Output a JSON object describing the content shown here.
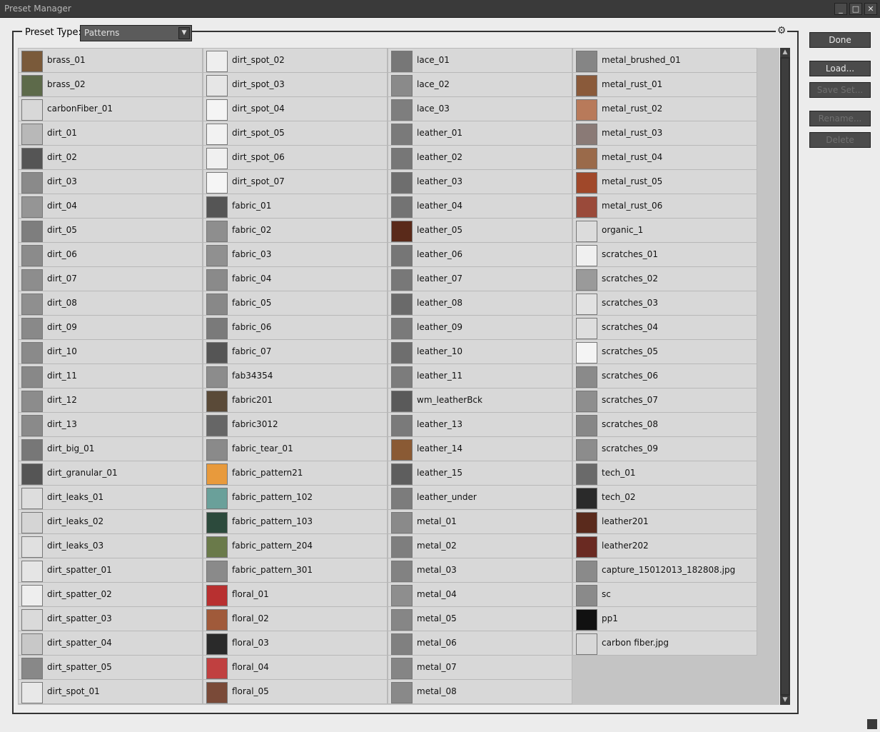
{
  "window": {
    "title": "Preset Manager"
  },
  "preset_type": {
    "label": "Preset Type:",
    "value": "Patterns"
  },
  "buttons": {
    "done": "Done",
    "load": "Load...",
    "save_set": "Save Set...",
    "rename": "Rename...",
    "delete": "Delete"
  },
  "columns": [
    [
      {
        "label": "brass_01",
        "color": "#7a5a3a"
      },
      {
        "label": "brass_02",
        "color": "#5d6a4a"
      },
      {
        "label": "carbonFiber_01",
        "color": "#d8d8d8"
      },
      {
        "label": "dirt_01",
        "color": "#b8b8b8"
      },
      {
        "label": "dirt_02",
        "color": "#555555"
      },
      {
        "label": "dirt_03",
        "color": "#8a8a8a"
      },
      {
        "label": "dirt_04",
        "color": "#959595"
      },
      {
        "label": "dirt_05",
        "color": "#7e7e7e"
      },
      {
        "label": "dirt_06",
        "color": "#8b8b8b"
      },
      {
        "label": "dirt_07",
        "color": "#8d8d8d"
      },
      {
        "label": "dirt_08",
        "color": "#8f8f8f"
      },
      {
        "label": "dirt_09",
        "color": "#898989"
      },
      {
        "label": "dirt_10",
        "color": "#8a8a8a"
      },
      {
        "label": "dirt_11",
        "color": "#888888"
      },
      {
        "label": "dirt_12",
        "color": "#8c8c8c"
      },
      {
        "label": "dirt_13",
        "color": "#8a8a8a"
      },
      {
        "label": "dirt_big_01",
        "color": "#777777"
      },
      {
        "label": "dirt_granular_01",
        "color": "#555555"
      },
      {
        "label": "dirt_leaks_01",
        "color": "#dddddd"
      },
      {
        "label": "dirt_leaks_02",
        "color": "#d5d5d5"
      },
      {
        "label": "dirt_leaks_03",
        "color": "#e0e0e0"
      },
      {
        "label": "dirt_spatter_01",
        "color": "#e5e5e5"
      },
      {
        "label": "dirt_spatter_02",
        "color": "#eeeeee"
      },
      {
        "label": "dirt_spatter_03",
        "color": "#dadada"
      },
      {
        "label": "dirt_spatter_04",
        "color": "#c8c8c8"
      },
      {
        "label": "dirt_spatter_05",
        "color": "#888888"
      },
      {
        "label": "dirt_spot_01",
        "color": "#e8e8e8"
      }
    ],
    [
      {
        "label": "dirt_spot_02",
        "color": "#eeeeee"
      },
      {
        "label": "dirt_spot_03",
        "color": "#e6e6e6"
      },
      {
        "label": "dirt_spot_04",
        "color": "#f4f4f4"
      },
      {
        "label": "dirt_spot_05",
        "color": "#f2f2f2"
      },
      {
        "label": "dirt_spot_06",
        "color": "#f0f0f0"
      },
      {
        "label": "dirt_spot_07",
        "color": "#f5f5f5"
      },
      {
        "label": "fabric_01",
        "color": "#555555"
      },
      {
        "label": "fabric_02",
        "color": "#8e8e8e"
      },
      {
        "label": "fabric_03",
        "color": "#909090"
      },
      {
        "label": "fabric_04",
        "color": "#8a8a8a"
      },
      {
        "label": "fabric_05",
        "color": "#888888"
      },
      {
        "label": "fabric_06",
        "color": "#7a7a7a"
      },
      {
        "label": "fabric_07",
        "color": "#555555"
      },
      {
        "label": "fab34354",
        "color": "#8c8c8c"
      },
      {
        "label": "fabric201",
        "color": "#5a4a38"
      },
      {
        "label": "fabric3012",
        "color": "#666666"
      },
      {
        "label": "fabric_tear_01",
        "color": "#8a8a8a"
      },
      {
        "label": "fabric_pattern21",
        "color": "#e89a3c"
      },
      {
        "label": "fabric_pattern_102",
        "color": "#6aa09a"
      },
      {
        "label": "fabric_pattern_103",
        "color": "#2c4a3c"
      },
      {
        "label": "fabric_pattern_204",
        "color": "#6a7a4a"
      },
      {
        "label": "fabric_pattern_301",
        "color": "#8a8a8a"
      },
      {
        "label": "floral_01",
        "color": "#b83030"
      },
      {
        "label": "floral_02",
        "color": "#a05a3a"
      },
      {
        "label": "floral_03",
        "color": "#2a2a2a"
      },
      {
        "label": "floral_04",
        "color": "#c04040"
      },
      {
        "label": "floral_05",
        "color": "#7a4a38"
      }
    ],
    [
      {
        "label": "lace_01",
        "color": "#777777"
      },
      {
        "label": "lace_02",
        "color": "#8a8a8a"
      },
      {
        "label": "lace_03",
        "color": "#7e7e7e"
      },
      {
        "label": "leather_01",
        "color": "#7a7a7a"
      },
      {
        "label": "leather_02",
        "color": "#777777"
      },
      {
        "label": "leather_03",
        "color": "#6e6e6e"
      },
      {
        "label": "leather_04",
        "color": "#737373"
      },
      {
        "label": "leather_05",
        "color": "#5a2a1a"
      },
      {
        "label": "leather_06",
        "color": "#767676"
      },
      {
        "label": "leather_07",
        "color": "#787878"
      },
      {
        "label": "leather_08",
        "color": "#6a6a6a"
      },
      {
        "label": "leather_09",
        "color": "#7a7a7a"
      },
      {
        "label": "leather_10",
        "color": "#6e6e6e"
      },
      {
        "label": "leather_11",
        "color": "#7c7c7c"
      },
      {
        "label": "wm_leatherBck",
        "color": "#5a5a5a"
      },
      {
        "label": "leather_13",
        "color": "#7a7a7a"
      },
      {
        "label": "leather_14",
        "color": "#8a5a34"
      },
      {
        "label": "leather_15",
        "color": "#5e5e5e"
      },
      {
        "label": "leather_under",
        "color": "#7c7c7c"
      },
      {
        "label": "metal_01",
        "color": "#8a8a8a"
      },
      {
        "label": "metal_02",
        "color": "#7e7e7e"
      },
      {
        "label": "metal_03",
        "color": "#828282"
      },
      {
        "label": "metal_04",
        "color": "#8e8e8e"
      },
      {
        "label": "metal_05",
        "color": "#868686"
      },
      {
        "label": "metal_06",
        "color": "#808080"
      },
      {
        "label": "metal_07",
        "color": "#858585"
      },
      {
        "label": "metal_08",
        "color": "#898989"
      }
    ],
    [
      {
        "label": "metal_brushed_01",
        "color": "#858585"
      },
      {
        "label": "metal_rust_01",
        "color": "#8a5a3a"
      },
      {
        "label": "metal_rust_02",
        "color": "#b87a5a"
      },
      {
        "label": "metal_rust_03",
        "color": "#8a7a76"
      },
      {
        "label": "metal_rust_04",
        "color": "#9a6a4a"
      },
      {
        "label": "metal_rust_05",
        "color": "#a0482a"
      },
      {
        "label": "metal_rust_06",
        "color": "#9a4a3a"
      },
      {
        "label": "organic_1",
        "color": "#dcdcdc"
      },
      {
        "label": "scratches_01",
        "color": "#f0f0f0"
      },
      {
        "label": "scratches_02",
        "color": "#9a9a9a"
      },
      {
        "label": "scratches_03",
        "color": "#e2e2e2"
      },
      {
        "label": "scratches_04",
        "color": "#dedede"
      },
      {
        "label": "scratches_05",
        "color": "#f4f4f4"
      },
      {
        "label": "scratches_06",
        "color": "#8a8a8a"
      },
      {
        "label": "scratches_07",
        "color": "#8e8e8e"
      },
      {
        "label": "scratches_08",
        "color": "#878787"
      },
      {
        "label": "scratches_09",
        "color": "#8c8c8c"
      },
      {
        "label": "tech_01",
        "color": "#6a6a6a"
      },
      {
        "label": "tech_02",
        "color": "#2a2a2a"
      },
      {
        "label": "leather201",
        "color": "#5a2a1c"
      },
      {
        "label": "leather202",
        "color": "#6a2a22"
      },
      {
        "label": "capture_15012013_182808.jpg",
        "color": "#8a8a8a"
      },
      {
        "label": "sc",
        "color": "#8a8a8a"
      },
      {
        "label": "pp1",
        "color": "#111111"
      },
      {
        "label": "carbon fiber.jpg",
        "color": "#d8d8d8"
      }
    ]
  ]
}
